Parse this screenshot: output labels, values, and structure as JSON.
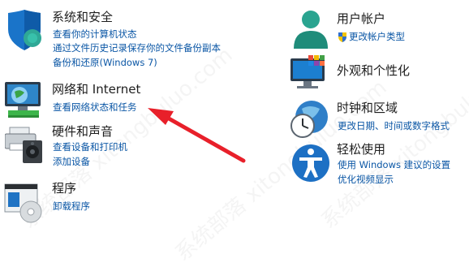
{
  "left": [
    {
      "title": "系统和安全",
      "links": [
        "查看你的计算机状态",
        "通过文件历史记录保存你的文件备份副本",
        "备份和还原(Windows 7)"
      ],
      "icon": "shield-icon"
    },
    {
      "title": "网络和 Internet",
      "links": [
        "查看网络状态和任务"
      ],
      "icon": "network-monitor-icon"
    },
    {
      "title": "硬件和声音",
      "links": [
        "查看设备和打印机",
        "添加设备"
      ],
      "icon": "printer-speaker-icon"
    },
    {
      "title": "程序",
      "links": [
        "卸载程序"
      ],
      "icon": "programs-icon"
    }
  ],
  "right": [
    {
      "title": "用户帐户",
      "links": [
        "更改帐户类型"
      ],
      "icon": "user-icon"
    },
    {
      "title": "外观和个性化",
      "links": [],
      "icon": "appearance-icon"
    },
    {
      "title": "时钟和区域",
      "links": [
        "更改日期、时间或数字格式"
      ],
      "icon": "clock-globe-icon"
    },
    {
      "title": "轻松使用",
      "links": [
        "使用 Windows 建议的设置",
        "优化视频显示"
      ],
      "icon": "accessibility-icon"
    }
  ],
  "watermark": "系统部落 xitongbuluo.com",
  "colors": {
    "link": "#0a56a5",
    "title": "#1e1e1e",
    "arrow": "#e8202a"
  }
}
